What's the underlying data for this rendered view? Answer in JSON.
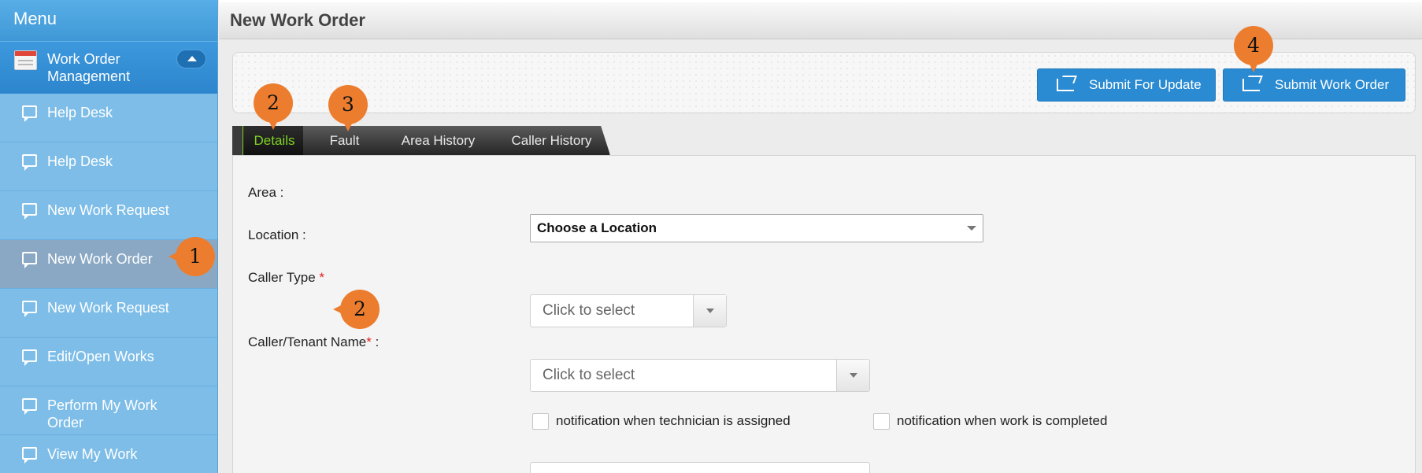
{
  "sidebar": {
    "title": "Menu",
    "section": "Work Order Management",
    "items": [
      {
        "label": "Help Desk"
      },
      {
        "label": "Help Desk"
      },
      {
        "label": "New Work Request"
      },
      {
        "label": "New Work Order"
      },
      {
        "label": "New Work Request"
      },
      {
        "label": "Edit/Open Works"
      },
      {
        "label": "Perform My Work Order"
      },
      {
        "label": "View My Work"
      }
    ]
  },
  "page": {
    "title": "New Work Order"
  },
  "actions": {
    "submit_update": "Submit For Update",
    "submit_order": "Submit Work Order"
  },
  "tabs": [
    {
      "label": "Details",
      "selected": true
    },
    {
      "label": "Fault"
    },
    {
      "label": "Area History"
    },
    {
      "label": "Caller History"
    }
  ],
  "form": {
    "area_label": "Area :",
    "location_label": "Location :",
    "location_value": "Choose a Location",
    "caller_type_label": "Caller Type",
    "caller_type_placeholder": "Click to select",
    "caller_name_label": "Caller/Tenant Name",
    "caller_name_placeholder": "Click to select",
    "required_mark": "*",
    "colon": ":",
    "notify_assigned": "notification when technician is assigned",
    "notify_completed": "notification when work is completed"
  },
  "markers": [
    "1",
    "2",
    "3",
    "2",
    "4"
  ],
  "colors": {
    "accent": "#2a8bd2",
    "sidebar": "#7dbde8",
    "marker": "#ec7d2e",
    "tab_selected": "#7ed321"
  }
}
